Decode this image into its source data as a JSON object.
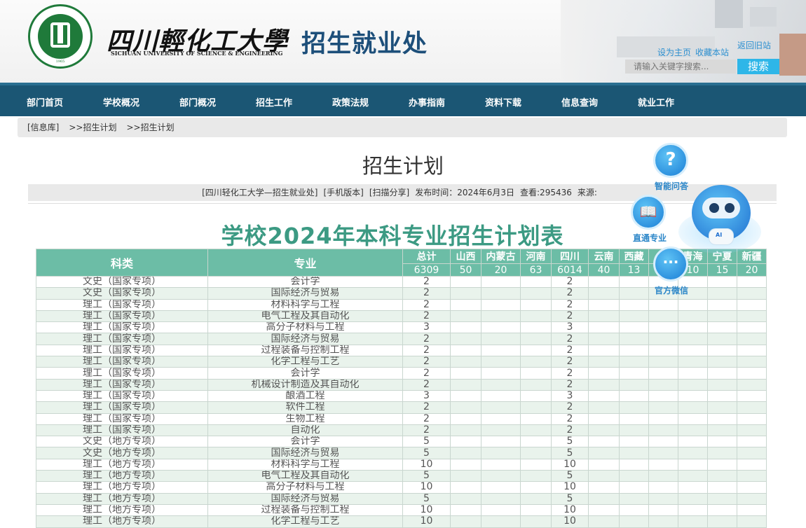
{
  "header": {
    "school_name_cn": "四川輕化工大學",
    "school_name_en": "SICHUAN UNIVERSITY OF SCIENCE & ENGINEERING",
    "logo_year": "1965",
    "department": "招生就业处",
    "links": {
      "set_home": "设为主页",
      "favorite": "收藏本站",
      "back_old": "返回旧站"
    },
    "search": {
      "placeholder": "请输入关键字搜索...",
      "button": "搜索"
    }
  },
  "nav": [
    "部门首页",
    "学校概况",
    "部门概况",
    "招生工作",
    "政策法规",
    "办事指南",
    "资料下载",
    "信息查询",
    "就业工作"
  ],
  "breadcrumb": [
    "[信息库]",
    ">>招生计划",
    ">>招生计划"
  ],
  "article": {
    "title": "招生计划",
    "meta": {
      "source_name": "[四川轻化工大学—招生就业处]",
      "mobile": "[手机版本]",
      "share": "[扫描分享]",
      "published": "发布时间：2024年6月3日",
      "views": "查看:295436",
      "origin": "来源:"
    }
  },
  "plan": {
    "title": "学校2024年本科专业招生计划表",
    "headers": {
      "category": "科类",
      "major": "专业",
      "provinces": [
        "总计",
        "山西",
        "内蒙古",
        "河南",
        "四川",
        "云南",
        "西藏",
        "",
        "青海",
        "宁夏",
        "新疆"
      ],
      "totals": [
        "6309",
        "50",
        "20",
        "63",
        "6014",
        "40",
        "13",
        "",
        "10",
        "15",
        "20"
      ]
    },
    "rows": [
      {
        "category": "文史（国家专项）",
        "major": "会计学",
        "total": "2",
        "sichuan": "2"
      },
      {
        "category": "文史（国家专项）",
        "major": "国际经济与贸易",
        "total": "2",
        "sichuan": "2"
      },
      {
        "category": "理工（国家专项）",
        "major": "材料科学与工程",
        "total": "2",
        "sichuan": "2"
      },
      {
        "category": "理工（国家专项）",
        "major": "电气工程及其自动化",
        "total": "2",
        "sichuan": "2"
      },
      {
        "category": "理工（国家专项）",
        "major": "高分子材料与工程",
        "total": "3",
        "sichuan": "3"
      },
      {
        "category": "理工（国家专项）",
        "major": "国际经济与贸易",
        "total": "2",
        "sichuan": "2"
      },
      {
        "category": "理工（国家专项）",
        "major": "过程装备与控制工程",
        "total": "2",
        "sichuan": "2"
      },
      {
        "category": "理工（国家专项）",
        "major": "化学工程与工艺",
        "total": "2",
        "sichuan": "2"
      },
      {
        "category": "理工（国家专项）",
        "major": "会计学",
        "total": "2",
        "sichuan": "2"
      },
      {
        "category": "理工（国家专项）",
        "major": "机械设计制造及其自动化",
        "total": "2",
        "sichuan": "2"
      },
      {
        "category": "理工（国家专项）",
        "major": "酿酒工程",
        "total": "3",
        "sichuan": "3"
      },
      {
        "category": "理工（国家专项）",
        "major": "软件工程",
        "total": "2",
        "sichuan": "2"
      },
      {
        "category": "理工（国家专项）",
        "major": "生物工程",
        "total": "2",
        "sichuan": "2"
      },
      {
        "category": "理工（国家专项）",
        "major": "自动化",
        "total": "2",
        "sichuan": "2"
      },
      {
        "category": "文史（地方专项）",
        "major": "会计学",
        "total": "5",
        "sichuan": "5"
      },
      {
        "category": "文史（地方专项）",
        "major": "国际经济与贸易",
        "total": "5",
        "sichuan": "5"
      },
      {
        "category": "理工（地方专项）",
        "major": "材料科学与工程",
        "total": "10",
        "sichuan": "10"
      },
      {
        "category": "理工（地方专项）",
        "major": "电气工程及其自动化",
        "total": "5",
        "sichuan": "5"
      },
      {
        "category": "理工（地方专项）",
        "major": "高分子材料与工程",
        "total": "10",
        "sichuan": "10"
      },
      {
        "category": "理工（地方专项）",
        "major": "国际经济与贸易",
        "total": "5",
        "sichuan": "5"
      },
      {
        "category": "理工（地方专项）",
        "major": "过程装备与控制工程",
        "total": "10",
        "sichuan": "10"
      },
      {
        "category": "理工（地方专项）",
        "major": "化学工程与工艺",
        "total": "10",
        "sichuan": "10"
      }
    ]
  },
  "widgets": {
    "qa": {
      "label": "智能问答",
      "glyph": "?"
    },
    "major": {
      "label": "直通专业",
      "glyph": "📖"
    },
    "wechat": {
      "label": "官方微信",
      "glyph": "···"
    },
    "robot_badge": "AI"
  },
  "colors": {
    "nav": "#1b5674",
    "table_header": "#6cbda6",
    "plan_title": "#3c9a83",
    "accent_blue": "#2b86c8"
  }
}
